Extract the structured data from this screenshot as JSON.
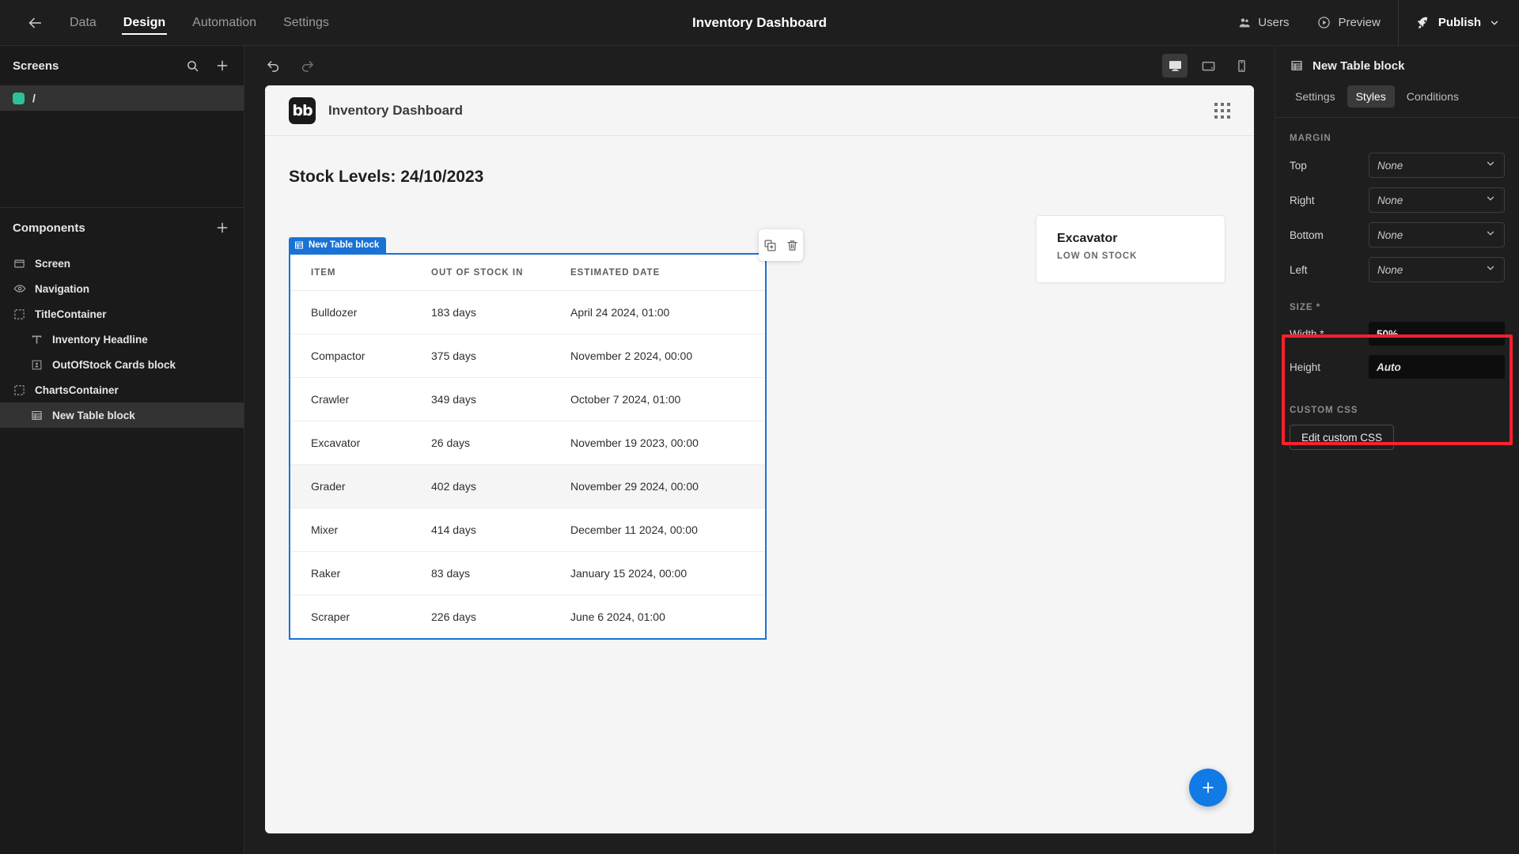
{
  "topbar": {
    "back_icon": "arrow-left-icon",
    "nav": [
      {
        "label": "Data",
        "active": false
      },
      {
        "label": "Design",
        "active": true
      },
      {
        "label": "Automation",
        "active": false
      },
      {
        "label": "Settings",
        "active": false
      }
    ],
    "app_title": "Inventory Dashboard",
    "users_label": "Users",
    "preview_label": "Preview",
    "publish_label": "Publish"
  },
  "left_panel": {
    "screens_title": "Screens",
    "screens_search_icon": "search-icon",
    "screens_add_icon": "plus-icon",
    "screens": [
      {
        "name": "/",
        "selected": true,
        "color": "#2bc29a"
      }
    ],
    "components_title": "Components",
    "components_add_icon": "plus-icon",
    "components": [
      {
        "label": "Screen",
        "icon": "screen-icon",
        "level": 1,
        "selected": false
      },
      {
        "label": "Navigation",
        "icon": "eye-icon",
        "level": 1,
        "selected": false
      },
      {
        "label": "TitleContainer",
        "icon": "container-icon",
        "level": 1,
        "selected": false
      },
      {
        "label": "Inventory Headline",
        "icon": "text-icon",
        "level": 2,
        "selected": false
      },
      {
        "label": "OutOfStock Cards block",
        "icon": "card-icon",
        "level": 2,
        "selected": false
      },
      {
        "label": "ChartsContainer",
        "icon": "container-icon",
        "level": 1,
        "selected": false
      },
      {
        "label": "New Table block",
        "icon": "table-icon",
        "level": 2,
        "selected": true
      }
    ]
  },
  "canvas_toolbar": {
    "undo_icon": "undo-icon",
    "redo_icon": "redo-icon",
    "devices": [
      {
        "name": "desktop-icon",
        "active": true
      },
      {
        "name": "tablet-icon",
        "active": false
      },
      {
        "name": "mobile-icon",
        "active": false
      }
    ]
  },
  "canvas": {
    "logo_text": "bb",
    "header_title": "Inventory Dashboard",
    "grid_icon": "grid-dots-icon",
    "stock_title": "Stock Levels: 24/10/2023",
    "float_toolbar": {
      "duplicate_icon": "duplicate-icon",
      "delete_icon": "trash-icon"
    },
    "card": {
      "title": "Excavator",
      "subtitle": "LOW ON STOCK"
    },
    "table": {
      "tag_label": "New Table block",
      "tag_icon": "table-icon",
      "selection_color": "#1a73d4",
      "columns": [
        "ITEM",
        "OUT OF STOCK IN",
        "ESTIMATED DATE"
      ],
      "rows": [
        {
          "item": "Bulldozer",
          "out_of_stock_in": "183 days",
          "estimated_date": "April 24 2024, 01:00"
        },
        {
          "item": "Compactor",
          "out_of_stock_in": "375 days",
          "estimated_date": "November 2 2024, 00:00"
        },
        {
          "item": "Crawler",
          "out_of_stock_in": "349 days",
          "estimated_date": "October 7 2024, 01:00"
        },
        {
          "item": "Excavator",
          "out_of_stock_in": "26 days",
          "estimated_date": "November 19 2023, 00:00"
        },
        {
          "item": "Grader",
          "out_of_stock_in": "402 days",
          "estimated_date": "November 29 2024, 00:00"
        },
        {
          "item": "Mixer",
          "out_of_stock_in": "414 days",
          "estimated_date": "December 11 2024, 00:00"
        },
        {
          "item": "Raker",
          "out_of_stock_in": "83 days",
          "estimated_date": "January 15 2024, 00:00"
        },
        {
          "item": "Scraper",
          "out_of_stock_in": "226 days",
          "estimated_date": "June 6 2024, 01:00"
        }
      ]
    },
    "fab_icon": "plus-icon",
    "fab_color": "#117ae4"
  },
  "right_panel": {
    "block_title": "New Table block",
    "block_icon": "table-icon",
    "tabs": [
      {
        "label": "Settings",
        "active": false
      },
      {
        "label": "Styles",
        "active": true
      },
      {
        "label": "Conditions",
        "active": false
      }
    ],
    "margin": {
      "section_label": "MARGIN",
      "fields": [
        {
          "label": "Top",
          "value": "None"
        },
        {
          "label": "Right",
          "value": "None"
        },
        {
          "label": "Bottom",
          "value": "None"
        },
        {
          "label": "Left",
          "value": "None"
        }
      ]
    },
    "size": {
      "section_label": "SIZE *",
      "highlight_color": "#ff1f2e",
      "fields": [
        {
          "label": "Width *",
          "value": "50%",
          "placeholder": false
        },
        {
          "label": "Height",
          "value": "Auto",
          "placeholder": true
        }
      ]
    },
    "custom_css": {
      "section_label": "CUSTOM CSS",
      "button_label": "Edit custom CSS"
    }
  }
}
